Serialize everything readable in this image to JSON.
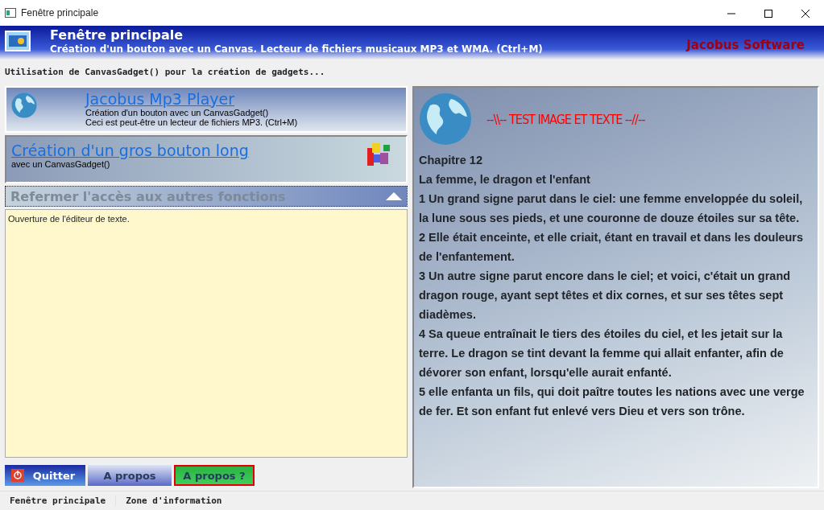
{
  "window": {
    "title": "Fenêtre principale"
  },
  "header": {
    "title": "Fenêtre principale",
    "subtitle": "Création d'un bouton avec un Canvas. Lecteur de fichiers musicaux MP3 et WMA. (Ctrl+M)",
    "brand": "Jacobus Software"
  },
  "info_line": "Utilisation de CanvasGadget() pour la création de gadgets...",
  "canvas_buttons": [
    {
      "kind": "globe",
      "title": "Jacobus Mp3 Player",
      "lines": [
        "Création d'un bouton avec un CanvasGadget()",
        "Ceci est peut-être un lecteur de fichiers MP3. (Ctrl+M)"
      ]
    },
    {
      "kind": "blocks",
      "title": "Création d'un gros bouton long",
      "lines": [
        "avec un CanvasGadget()"
      ]
    }
  ],
  "collapse": {
    "label": "Refermer l'accès aux autres fonctions",
    "expanded": true,
    "content": "Ouverture de l'éditeur de texte."
  },
  "footer_buttons": [
    {
      "kind": "quit",
      "label": "Quitter",
      "focused": false
    },
    {
      "kind": "about",
      "label": "A propos",
      "focused": false
    },
    {
      "kind": "help",
      "label": "A propos ?",
      "focused": true
    }
  ],
  "reader": {
    "title": "--\\\\-- TEST IMAGE ET TEXTE --//--",
    "paragraphs": [
      "Chapitre 12",
      "La femme, le dragon et l'enfant",
      "1 Un grand signe parut dans le ciel: une femme enveloppée du soleil, la lune sous ses pieds, et une couronne de douze étoiles sur sa tête.",
      "2 Elle était enceinte, et elle criait, étant en travail et dans les douleurs de l'enfantement.",
      "3 Un autre signe parut encore dans le ciel; et voici, c'était un grand dragon rouge, ayant sept têtes et dix cornes, et sur ses têtes sept diadèmes.",
      "4 Sa queue entraînait le tiers des étoiles du ciel, et les jetait sur la terre. Le dragon se tint devant la femme qui allait enfanter, afin de dévorer son enfant, lorsqu'elle aurait enfanté.",
      "5 elle enfanta un fils, qui doit paître toutes les nations avec une verge de fer. Et son enfant fut enlevé vers Dieu et vers son trône."
    ]
  },
  "status_bar": [
    "Fenêtre principale",
    "Zone d'information"
  ]
}
